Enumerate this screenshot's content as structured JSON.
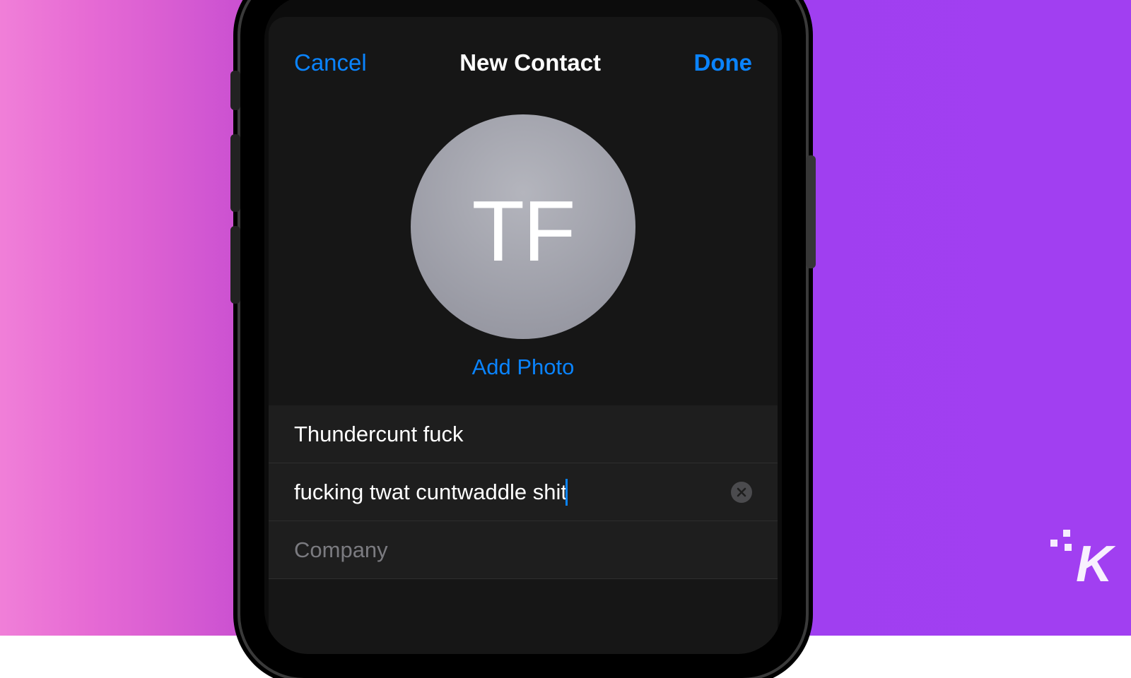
{
  "navbar": {
    "cancel": "Cancel",
    "title": "New Contact",
    "done": "Done"
  },
  "avatar": {
    "initials": "TF",
    "add_photo": "Add Photo"
  },
  "fields": {
    "first_name": {
      "value": "Thundercunt fuck"
    },
    "last_name": {
      "value": "fucking twat cuntwaddle shit"
    },
    "company": {
      "placeholder": "Company",
      "value": ""
    }
  },
  "watermark": "K",
  "colors": {
    "ios_blue": "#0a84ff"
  }
}
